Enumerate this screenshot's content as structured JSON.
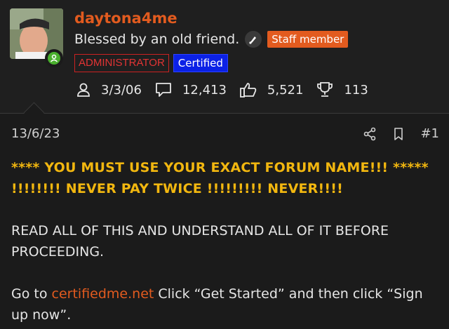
{
  "author": {
    "username": "daytona4me",
    "status": "Blessed by an old friend.",
    "staff_label": "Staff member",
    "admin_label": "ADMINISTRATOR",
    "certified_label": "Certified",
    "stats": {
      "joined": "3/3/06",
      "messages": "12,413",
      "reactions": "5,521",
      "points": "113"
    }
  },
  "post": {
    "date": "13/6/23",
    "number": "#1",
    "warning_line1": "**** YOU MUST USE YOUR EXACT FORUM NAME!!! *****",
    "warning_line2": "!!!!!!!! NEVER PAY TWICE !!!!!!!!! NEVER!!!!",
    "paragraph1": "READ ALL OF THIS AND UNDERSTAND ALL OF IT BEFORE PROCEEDING.",
    "paragraph2_prefix": "Go to ",
    "paragraph2_link": "certifiedme.net",
    "paragraph2_suffix": " Click “Get Started” and then click “Sign up now”."
  },
  "colors": {
    "brand": "#e25b1f",
    "warning": "#f2b70f",
    "admin": "#e33434",
    "certified": "#0b21e6",
    "online": "#49b02d"
  }
}
